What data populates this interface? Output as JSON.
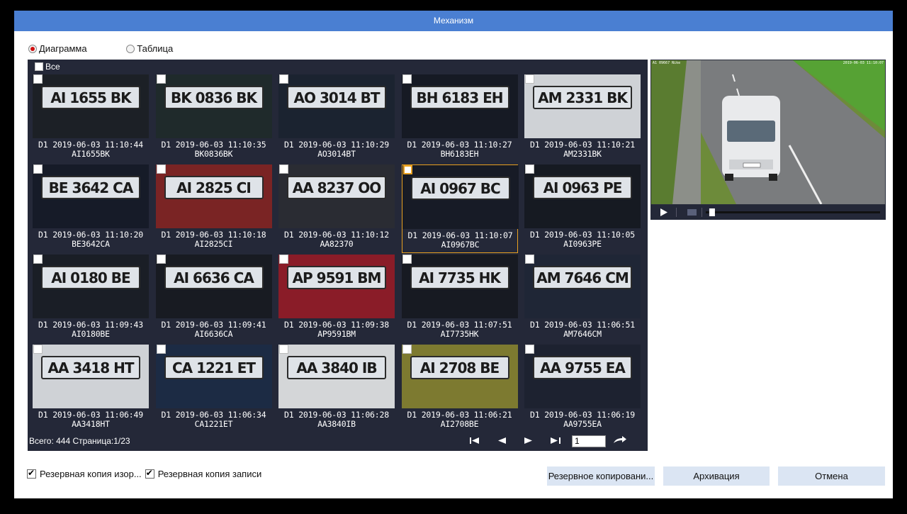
{
  "window": {
    "title": "Механизм"
  },
  "view_mode": {
    "options": [
      {
        "label": "Диаграмма",
        "selected": true
      },
      {
        "label": "Таблица",
        "selected": false
      }
    ]
  },
  "grid": {
    "select_all_label": "Все",
    "tiles": [
      {
        "plate": "AI 1655 BK",
        "line1": "D1 2019-06-03 11:10:44",
        "line2": "AI1655BK",
        "bg": "#1c2026",
        "selected": false
      },
      {
        "plate": "BK 0836 BK",
        "line1": "D1 2019-06-03 11:10:35",
        "line2": "BK0836BK",
        "bg": "#1f2a2b",
        "selected": false
      },
      {
        "plate": "AO 3014 BT",
        "line1": "D1 2019-06-03 11:10:29",
        "line2": "AO3014BT",
        "bg": "#1b2330",
        "selected": false
      },
      {
        "plate": "BH 6183 EH",
        "line1": "D1 2019-06-03 11:10:27",
        "line2": "BH6183EH",
        "bg": "#161a24",
        "selected": false
      },
      {
        "plate": "AM 2331 BK",
        "line1": "D1 2019-06-03 11:10:21",
        "line2": "AM2331BK",
        "bg": "#cfd2d6",
        "selected": false
      },
      {
        "plate": "BE 3642 CA",
        "line1": "D1 2019-06-03 11:10:20",
        "line2": "BE3642CA",
        "bg": "#161b28",
        "selected": false
      },
      {
        "plate": "AI 2825 CI",
        "line1": "D1 2019-06-03 11:10:18",
        "line2": "AI2825CI",
        "bg": "#7a2424",
        "selected": false
      },
      {
        "plate": "AA 8237 OO",
        "line1": "D1 2019-06-03 11:10:12",
        "line2": "AA82370",
        "bg": "#2a2c33",
        "selected": false
      },
      {
        "plate": "AI 0967 BC",
        "line1": "D1 2019-06-03 11:10:07",
        "line2": "AI0967BC",
        "bg": "#171b26",
        "selected": true
      },
      {
        "plate": "AI 0963 PE",
        "line1": "D1 2019-06-03 11:10:05",
        "line2": "AI0963PE",
        "bg": "#161a22",
        "selected": false
      },
      {
        "plate": "AI 0180 BE",
        "line1": "D1 2019-06-03 11:09:43",
        "line2": "AI0180BE",
        "bg": "#1a1e26",
        "selected": false
      },
      {
        "plate": "AI 6636 CA",
        "line1": "D1 2019-06-03 11:09:41",
        "line2": "AI6636CA",
        "bg": "#181b22",
        "selected": false
      },
      {
        "plate": "AP 9591 BM",
        "line1": "D1 2019-06-03 11:09:38",
        "line2": "AP9591BM",
        "bg": "#8a1c28",
        "selected": false
      },
      {
        "plate": "AI 7735 HK",
        "line1": "D1 2019-06-03 11:07:51",
        "line2": "AI7735HK",
        "bg": "#171a22",
        "selected": false
      },
      {
        "plate": "AM 7646 CM",
        "line1": "D1 2019-06-03 11:06:51",
        "line2": "AM7646CM",
        "bg": "#1f2636",
        "selected": false
      },
      {
        "plate": "AA 3418 HT",
        "line1": "D1 2019-06-03 11:06:49",
        "line2": "AA3418HT",
        "bg": "#cfd2d6",
        "selected": false
      },
      {
        "plate": "CA 1221 ET",
        "line1": "D1 2019-06-03 11:06:34",
        "line2": "CA1221ET",
        "bg": "#1c2b44",
        "selected": false
      },
      {
        "plate": "AA 3840 IB",
        "line1": "D1 2019-06-03 11:06:28",
        "line2": "AA3840IB",
        "bg": "#d4d6d8",
        "selected": false
      },
      {
        "plate": "AI 2708 BE",
        "line1": "D1 2019-06-03 11:06:21",
        "line2": "AI2708BE",
        "bg": "#7d7a30",
        "selected": false
      },
      {
        "plate": "AA 9755 EA",
        "line1": "D1 2019-06-03 11:06:19",
        "line2": "AA9755EA",
        "bg": "#1d2230",
        "selected": false
      }
    ],
    "total_text": "Всего: 444  Страница:1/23",
    "page_input_value": "1"
  },
  "player": {
    "stamp_left": "A1 09667 Nike",
    "stamp_right": "2019-06-03 11:10:07",
    "progress": 0.02
  },
  "options": {
    "backup_image_label": "Резервная копия изор...",
    "backup_record_label": "Резервная копия записи"
  },
  "buttons": {
    "backup": "Резервное копировани...",
    "archive": "Архивация",
    "cancel": "Отмена"
  },
  "colors": {
    "title_bar": "#4a7fd2",
    "panel": "#242838",
    "selection": "#e8a020",
    "button": "#dbe5f3"
  }
}
